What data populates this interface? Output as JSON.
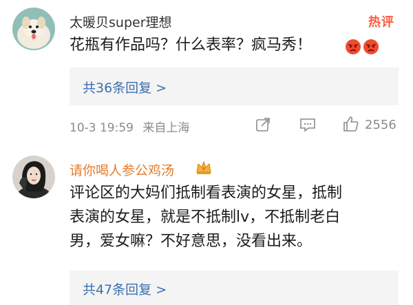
{
  "comments": [
    {
      "user": "太暖贝super理想",
      "hot_badge": "热评",
      "text": "花瓶有作品吗？什么表率？疯马秀！",
      "replies": "共36条回复 >",
      "date": "10-3 19:59",
      "location": "来自上海",
      "likes": "2556",
      "emoji": [
        "angry-face",
        "angry-face"
      ]
    },
    {
      "user": "请你喝人参公鸡汤",
      "badge_icon": "crown",
      "text_lines": [
        "评论区的大妈们抵制看表演的女星，抵制",
        "表演的女星，就是不抵制lv，不抵制老白",
        "男，爱女嘛？不好意思，没看出来。"
      ],
      "replies": "共47条回复 >"
    }
  ],
  "colors": {
    "link": "#3a6fb0",
    "username_vip": "#e87a2a",
    "username": "#333333",
    "hot": "#ff5a3a",
    "meta": "#8a8a8a"
  }
}
